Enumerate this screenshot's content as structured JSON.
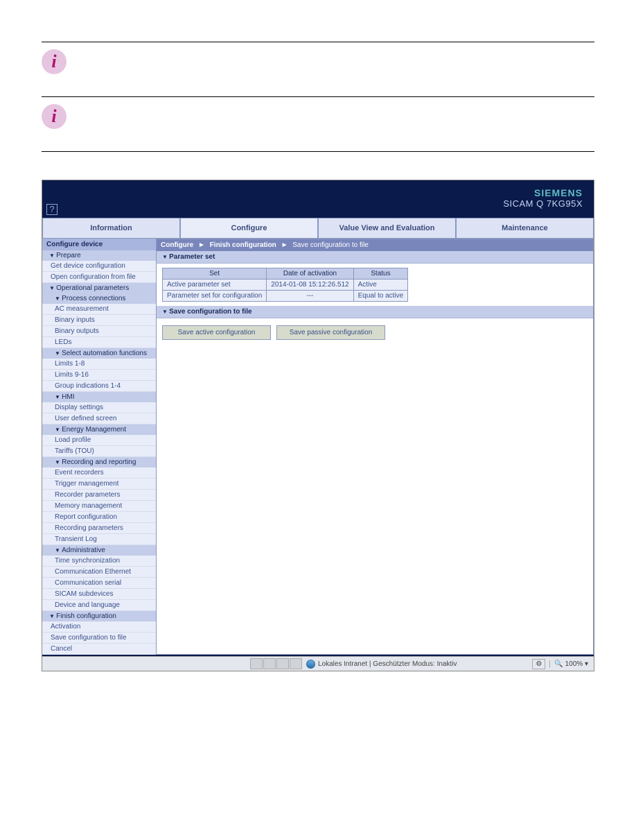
{
  "brand": {
    "company": "SIEMENS",
    "product": "SICAM Q 7KG95X"
  },
  "tabs": {
    "info": "Information",
    "configure": "Configure",
    "valueview": "Value View and Evaluation",
    "maintenance": "Maintenance"
  },
  "breadcrumb": {
    "a": "Configure",
    "b": "Finish configuration",
    "c": "Save configuration to file"
  },
  "sidebar": {
    "title": "Configure device",
    "prepare": {
      "head": "Prepare",
      "get": "Get device configuration",
      "open": "Open configuration from file"
    },
    "operational": {
      "head": "Operational parameters"
    },
    "process": {
      "head": "Process connections",
      "ac": "AC measurement",
      "binin": "Binary inputs",
      "binout": "Binary outputs",
      "leds": "LEDs"
    },
    "automation": {
      "head": "Select automation functions",
      "l18": "Limits 1-8",
      "l916": "Limits 9-16",
      "grp": "Group indications 1-4"
    },
    "hmi": {
      "head": "HMI",
      "disp": "Display settings",
      "user": "User defined screen"
    },
    "energy": {
      "head": "Energy Management",
      "load": "Load profile",
      "tariffs": "Tariffs (TOU)"
    },
    "recording": {
      "head": "Recording and reporting",
      "evt": "Event recorders",
      "trig": "Trigger management",
      "recp": "Recorder parameters",
      "mem": "Memory management",
      "rept": "Report configuration",
      "recparam": "Recording parameters",
      "trans": "Transient Log"
    },
    "admin": {
      "head": "Administrative",
      "time": "Time synchronization",
      "eth": "Communication Ethernet",
      "serial": "Communication serial",
      "sub": "SICAM subdevices",
      "dev": "Device and language"
    },
    "finish": {
      "head": "Finish configuration",
      "act": "Activation",
      "save": "Save configuration to file",
      "cancel": "Cancel"
    }
  },
  "paramset": {
    "title": "Parameter set",
    "cols": {
      "set": "Set",
      "date": "Date of activation",
      "status": "Status"
    },
    "rows": [
      {
        "set": "Active parameter set",
        "date": "2014-01-08 15:12:26.512",
        "status": "Active"
      },
      {
        "set": "Parameter set for configuration",
        "date": "---",
        "status": "Equal to active"
      }
    ]
  },
  "saveconfig": {
    "title": "Save configuration to file",
    "active": "Save active configuration",
    "passive": "Save passive configuration"
  },
  "statusbar": {
    "zone": "Lokales Intranet | Geschützter Modus: Inaktiv",
    "zoom": "100%"
  }
}
